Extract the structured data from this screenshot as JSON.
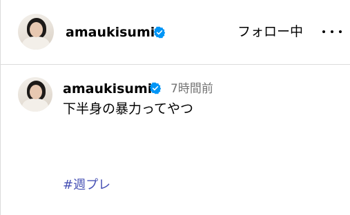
{
  "header": {
    "username": "amaukisumi",
    "follow_status": "フォロー中",
    "more_icon": "more-horizontal-icon",
    "verified_icon": "verified-badge-icon"
  },
  "post": {
    "username": "amaukisumi",
    "timestamp": "7時間前",
    "caption": "下半身の暴力ってやつ",
    "hashtag": "#週プレ"
  },
  "colors": {
    "verified": "#0095f6",
    "hashtag": "#4650b4",
    "timestamp": "#737373",
    "divider": "#dbdbdb"
  }
}
